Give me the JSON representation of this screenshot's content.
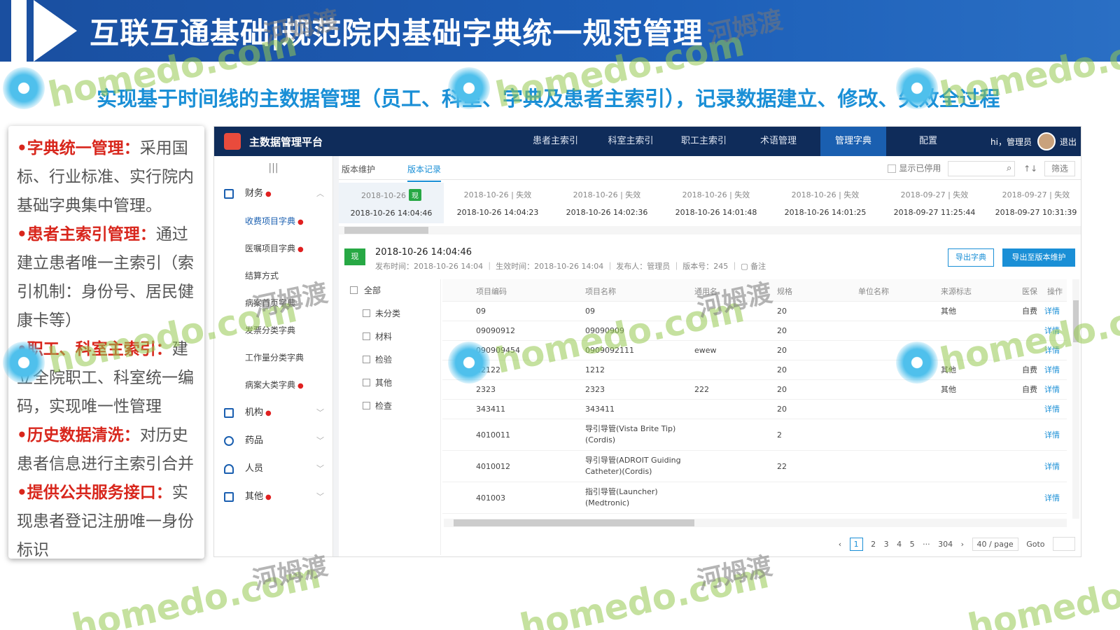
{
  "slide": {
    "title": "互联互通基础|规范院内基础字典统一规范管理",
    "subtitle": "实现基于时间线的主数据管理（员工、科室、字典及患者主索引），记录数据建立、修改、失效全过程"
  },
  "sidecard": {
    "items": [
      {
        "head": "•字典统一管理：",
        "body": "采用国标、行业标准、实行院内基础字典集中管理。"
      },
      {
        "head": "•患者主索引管理：",
        "body": "通过建立患者唯一主索引（索引机制：身份号、居民健康卡等）"
      },
      {
        "head": "•职工、科室主索引：",
        "body": "建立全院职工、科室统一编码，实现唯一性管理"
      },
      {
        "head": "•历史数据清洗：",
        "body": "对历史患者信息进行主索引合并"
      },
      {
        "head": "•提供公共服务接口：",
        "body": "实现患者登记注册唯一身份标识"
      }
    ]
  },
  "app": {
    "brand": "主数据管理平台",
    "nav": [
      "患者主索引",
      "科室主索引",
      "职工主索引",
      "术语管理",
      "管理字典",
      "配置"
    ],
    "user": "hi，管理员",
    "logout": "退出",
    "leftnav": {
      "collapse": "|||",
      "finance": "财务",
      "subs": [
        "收费项目字典",
        "医嘱项目字典",
        "结算方式",
        "病案首页字典",
        "发票分类字典",
        "工作量分类字典",
        "病案大类字典"
      ],
      "groups": [
        "机构",
        "药品",
        "人员",
        "其他"
      ]
    },
    "subtabs": [
      "版本维护",
      "版本记录"
    ],
    "tools": {
      "show_disabled": "显示已停用",
      "sort": "↑↓",
      "filter": "筛选"
    },
    "timeline": [
      {
        "top": "2018-10-26",
        "badge": "现",
        "bot": "2018-10-26 14:04:46"
      },
      {
        "top": "2018-10-26 | 失效",
        "bot": "2018-10-26 14:04:23"
      },
      {
        "top": "2018-10-26 | 失效",
        "bot": "2018-10-26 14:02:36"
      },
      {
        "top": "2018-10-26 | 失效",
        "bot": "2018-10-26 14:01:48"
      },
      {
        "top": "2018-10-26 | 失效",
        "bot": "2018-10-26 14:01:25"
      },
      {
        "top": "2018-09-27 | 失效",
        "bot": "2018-09-27 11:25:44"
      },
      {
        "top": "2018-09-27 | 失效",
        "bot": "2018-09-27 10:31:39"
      }
    ],
    "info": {
      "badge": "现",
      "title": "2018-10-26 14:04:46",
      "meta": "发布时间：2018-10-26 14:04 ｜ 生效时间：2018-10-26 14:04 ｜ 发布人：管理员 ｜ 版本号：245 ｜ ▢ 备注",
      "export": "导出字典",
      "export_to": "导出至版本维护"
    },
    "tree": {
      "root": "全部",
      "children": [
        "未分类",
        "材料",
        "检验",
        "其他",
        "检查"
      ]
    },
    "table": {
      "headers": [
        "项目编码",
        "项目名称",
        "通用名",
        "规格",
        "单位名称",
        "来源标志",
        "医保",
        "操作"
      ],
      "rows": [
        {
          "code": "09",
          "name": "09",
          "generic": "",
          "spec": "20",
          "src": "其他",
          "ins": "自费",
          "op": "详情"
        },
        {
          "code": "09090912",
          "name": "09090909",
          "generic": "",
          "spec": "20",
          "src": "",
          "ins": "",
          "op": "详情"
        },
        {
          "code": "090909454",
          "name": "0909092111",
          "generic": "ewew",
          "spec": "20",
          "src": "",
          "ins": "",
          "op": "详情"
        },
        {
          "code": "12122",
          "name": "1212",
          "generic": "",
          "spec": "20",
          "src": "其他",
          "ins": "自费",
          "op": "详情"
        },
        {
          "code": "2323",
          "name": "2323",
          "generic": "222",
          "spec": "20",
          "src": "其他",
          "ins": "自费",
          "op": "详情"
        },
        {
          "code": "343411",
          "name": "343411",
          "generic": "",
          "spec": "20",
          "src": "",
          "ins": "",
          "op": "详情"
        },
        {
          "code": "4010011",
          "name": "导引导管(Vista Brite Tip)(Cordis)",
          "generic": "",
          "spec": "2",
          "src": "",
          "ins": "",
          "op": "详情"
        },
        {
          "code": "4010012",
          "name": "导引导管(ADROIT Guiding Catheter)(Cordis)",
          "generic": "",
          "spec": "22",
          "src": "",
          "ins": "",
          "op": "详情"
        },
        {
          "code": "401003",
          "name": "指引导管(Launcher)(Medtronic)",
          "generic": "",
          "spec": "",
          "src": "",
          "ins": "",
          "op": "详情"
        }
      ]
    },
    "pager": {
      "prev": "‹",
      "pages": [
        "1",
        "2",
        "3",
        "4",
        "5",
        "···",
        "304"
      ],
      "next": "›",
      "size": "40 / page",
      "goto": "Goto"
    }
  },
  "watermark": {
    "en": "homedo.com",
    "cn": "河姆渡"
  },
  "colors": {
    "banner": "#1a4fa0",
    "accent": "#1a8fd6",
    "nav": "#0f2c5a",
    "highlight": "#d8261c",
    "current": "#27a844"
  }
}
